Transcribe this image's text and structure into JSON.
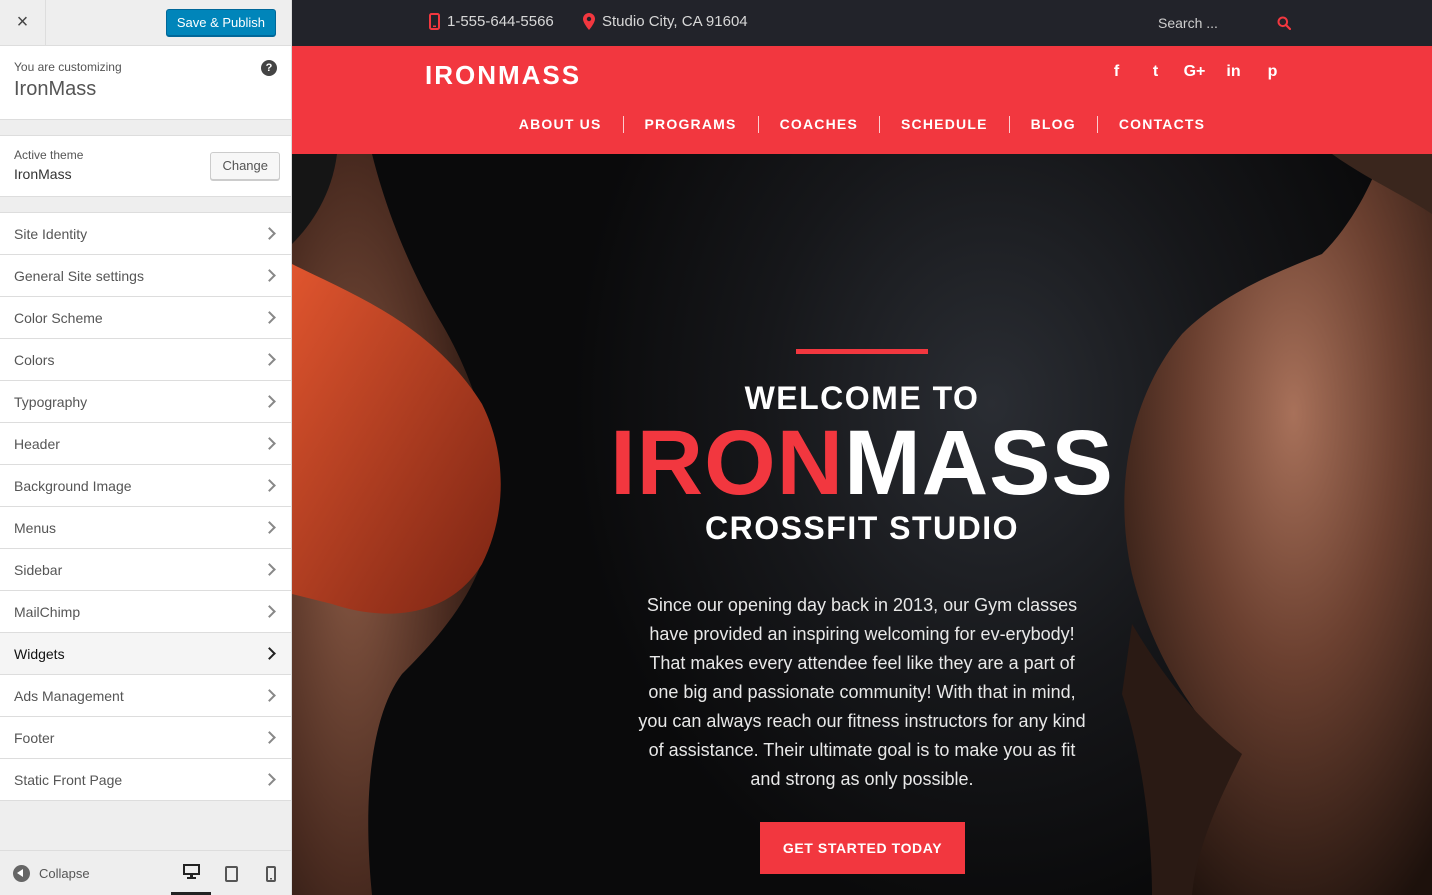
{
  "customizer": {
    "close_label": "×",
    "publish_label": "Save & Publish",
    "customizing_label": "You are customizing",
    "site_name": "IronMass",
    "help_label": "?",
    "active_theme_label": "Active theme",
    "active_theme_name": "IronMass",
    "change_label": "Change",
    "menu": [
      "Site Identity",
      "General Site settings",
      "Color Scheme",
      "Colors",
      "Typography",
      "Header",
      "Background Image",
      "Menus",
      "Sidebar",
      "MailChimp",
      "Widgets",
      "Ads Management",
      "Footer",
      "Static Front Page"
    ],
    "active_menu": "Widgets",
    "collapse_label": "Collapse"
  },
  "site": {
    "phone": "1-555-644-5566",
    "location": "Studio City, CA 91604",
    "search_placeholder": "Search ...",
    "logo": "IRONMASS",
    "social": [
      "facebook",
      "twitter",
      "google-plus",
      "linkedin",
      "pinterest"
    ],
    "social_glyphs": [
      "f",
      "t",
      "G+",
      "in",
      "p"
    ],
    "nav": [
      "ABOUT US",
      "PROGRAMS",
      "COACHES",
      "SCHEDULE",
      "BLOG",
      "CONTACTS"
    ],
    "hero": {
      "welcome": "WELCOME TO",
      "brand_red": "IRON",
      "brand_white": "MASS",
      "subtitle": "CROSSFIT STUDIO",
      "text": "Since our opening day back in 2013, our Gym classes have provided an inspiring welcoming for ev-erybody! That makes every attendee feel like they are a part of one big and passionate community! With that in mind, you can always reach our fitness instructors for any kind of assistance. Their ultimate goal is to make you as fit and strong as only possible.",
      "cta": "GET STARTED TODAY"
    }
  },
  "colors": {
    "accent": "#f2373f",
    "topbar": "#22232a",
    "wp_blue": "#0085ba"
  }
}
